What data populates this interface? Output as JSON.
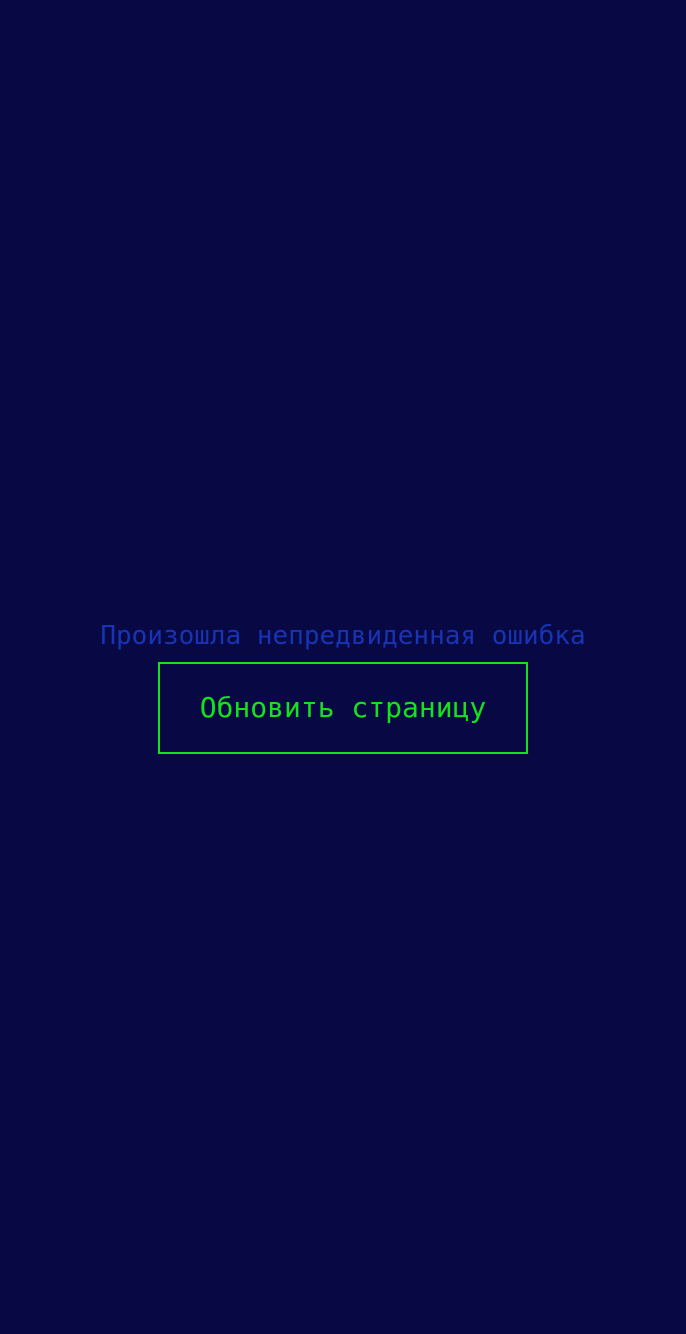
{
  "error": {
    "message": "Произошла непредвиденная ошибка",
    "reload_label": "Обновить страницу"
  },
  "colors": {
    "background": "#080845",
    "message_text": "#1634b3",
    "button_accent": "#16e21b"
  }
}
